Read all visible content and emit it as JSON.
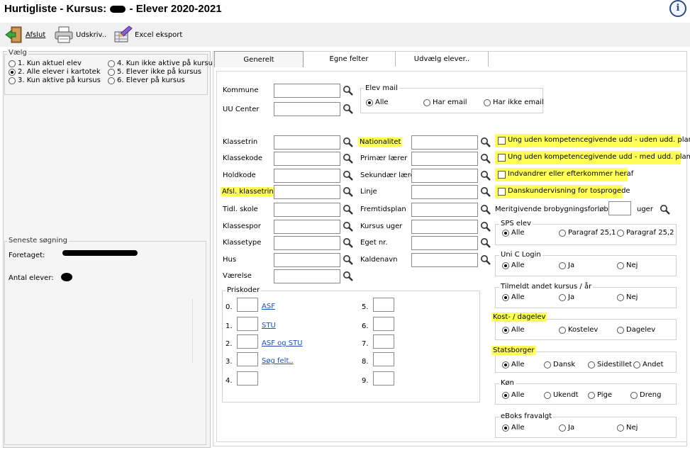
{
  "header": {
    "title_prefix": "Hurtigliste - Kursus:",
    "title_suffix": "- Elever 2020-2021",
    "info_glyph": "i"
  },
  "toolbar": {
    "afslut": "Afslut",
    "udskriv": "Udskriv..",
    "excel": "Excel eksport"
  },
  "left": {
    "vaelg_caption": "Vælg",
    "options": [
      "1. Kun aktuel elev",
      "2. Alle elever i kartotek",
      "3. Kun aktive på kursus",
      "4. Kun ikke aktive på kursus",
      "5. Elever ikke på kursus",
      "6. Elever på kursus"
    ],
    "selected_option": 1,
    "seneste_caption": "Seneste søgning",
    "foretaget_label": "Foretaget:",
    "antal_label": "Antal elever:"
  },
  "tabs": [
    "Generelt",
    "Egne felter",
    "Udvælg elever.."
  ],
  "form": {
    "kommune": "Kommune",
    "uu_center": "UU Center",
    "elev_mail": {
      "caption": "Elev mail",
      "options": [
        "Alle",
        "Har email",
        "Har ikke email"
      ],
      "selected": 0
    },
    "col1_labels": [
      "Klassetrin",
      "Klassekode",
      "Holdkode",
      "Afsl. klassetrin",
      "Tidl. skole",
      "Klassespor",
      "Klassetype",
      "Hus",
      "Værelse"
    ],
    "col2_labels": [
      "Nationalitet",
      "Primær lærer",
      "Sekundær lærer",
      "Linje",
      "Fremtidsplan",
      "Kursus uger",
      "Eget nr.",
      "Kaldenavn"
    ],
    "checks": [
      "Ung uden kompetencegivende udd - uden udd. plan",
      "Ung uden kompetencegivende udd - med udd. plan",
      "Indvandrer eller efterkommer heraf",
      "Danskundervisning for tosprogede"
    ],
    "merit_label": "Meritgivende brobygningsforløb",
    "uger_label": "uger",
    "priskoder": {
      "caption": "Priskoder",
      "left_nums": [
        "0.",
        "1.",
        "2.",
        "3.",
        "4."
      ],
      "links": [
        "ASF",
        "STU",
        "ASF og STU",
        "Søg felt.."
      ],
      "right_nums": [
        "5.",
        "6.",
        "7.",
        "8.",
        "9."
      ]
    },
    "groups": [
      {
        "caption": "SPS elev",
        "options": [
          "Alle",
          "Paragraf 25,1",
          "Paragraf 25,2"
        ],
        "selected": 0
      },
      {
        "caption": "Uni C Login",
        "options": [
          "Alle",
          "Ja",
          "Nej"
        ],
        "selected": 0
      },
      {
        "caption": "Tilmeldt andet kursus / år",
        "options": [
          "Alle",
          "Ja",
          "Nej"
        ],
        "selected": 0
      },
      {
        "caption": "Kost- / dagelev",
        "options": [
          "Alle",
          "Kostelev",
          "Dagelev"
        ],
        "selected": 0
      },
      {
        "caption": "Statsborger",
        "options": [
          "Alle",
          "Dansk",
          "Sidestillet",
          "Andet"
        ],
        "selected": 0
      },
      {
        "caption": "Køn",
        "options": [
          "Alle",
          "Ukendt",
          "Pige",
          "Dreng"
        ],
        "selected": 0
      },
      {
        "caption": "eBoks fravalgt",
        "options": [
          "Alle",
          "Ja",
          "Nej"
        ],
        "selected": 0
      }
    ]
  },
  "colors": {
    "highlight": "#ffff55",
    "link": "#1a4fc8"
  }
}
